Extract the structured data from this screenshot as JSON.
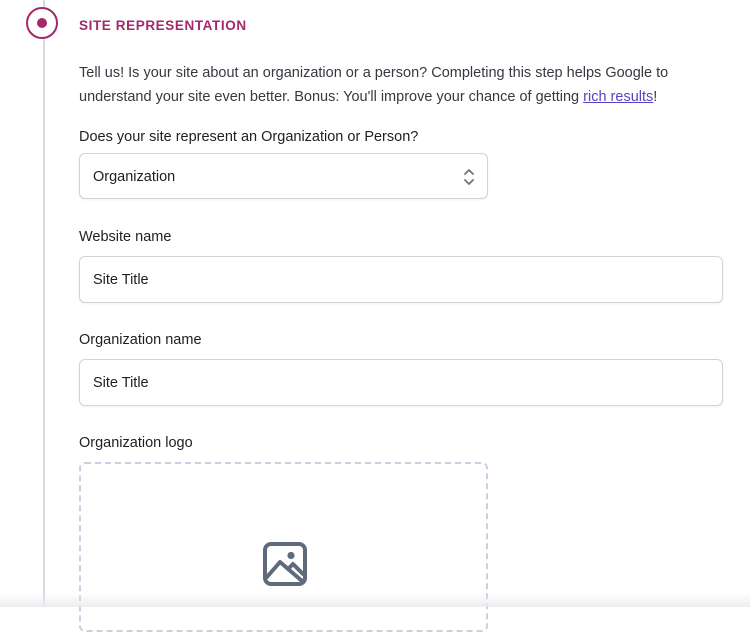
{
  "step": {
    "title": "SITE REPRESENTATION",
    "accent_color": "#a4286a"
  },
  "intro": {
    "text_before_link": "Tell us! Is your site about an organization or a person? Completing this step helps Google to understand your site even better. Bonus: You'll improve your chance of getting ",
    "link_text": "rich results",
    "text_after_link": "!"
  },
  "represent_field": {
    "label": "Does your site represent an Organization or Person?",
    "selected_value": "Organization",
    "icon": "chevron-up-down-icon"
  },
  "website_name_field": {
    "label": "Website name",
    "value": "Site Title"
  },
  "organization_name_field": {
    "label": "Organization name",
    "value": "Site Title"
  },
  "organization_logo_field": {
    "label": "Organization logo",
    "icon": "image-icon"
  }
}
